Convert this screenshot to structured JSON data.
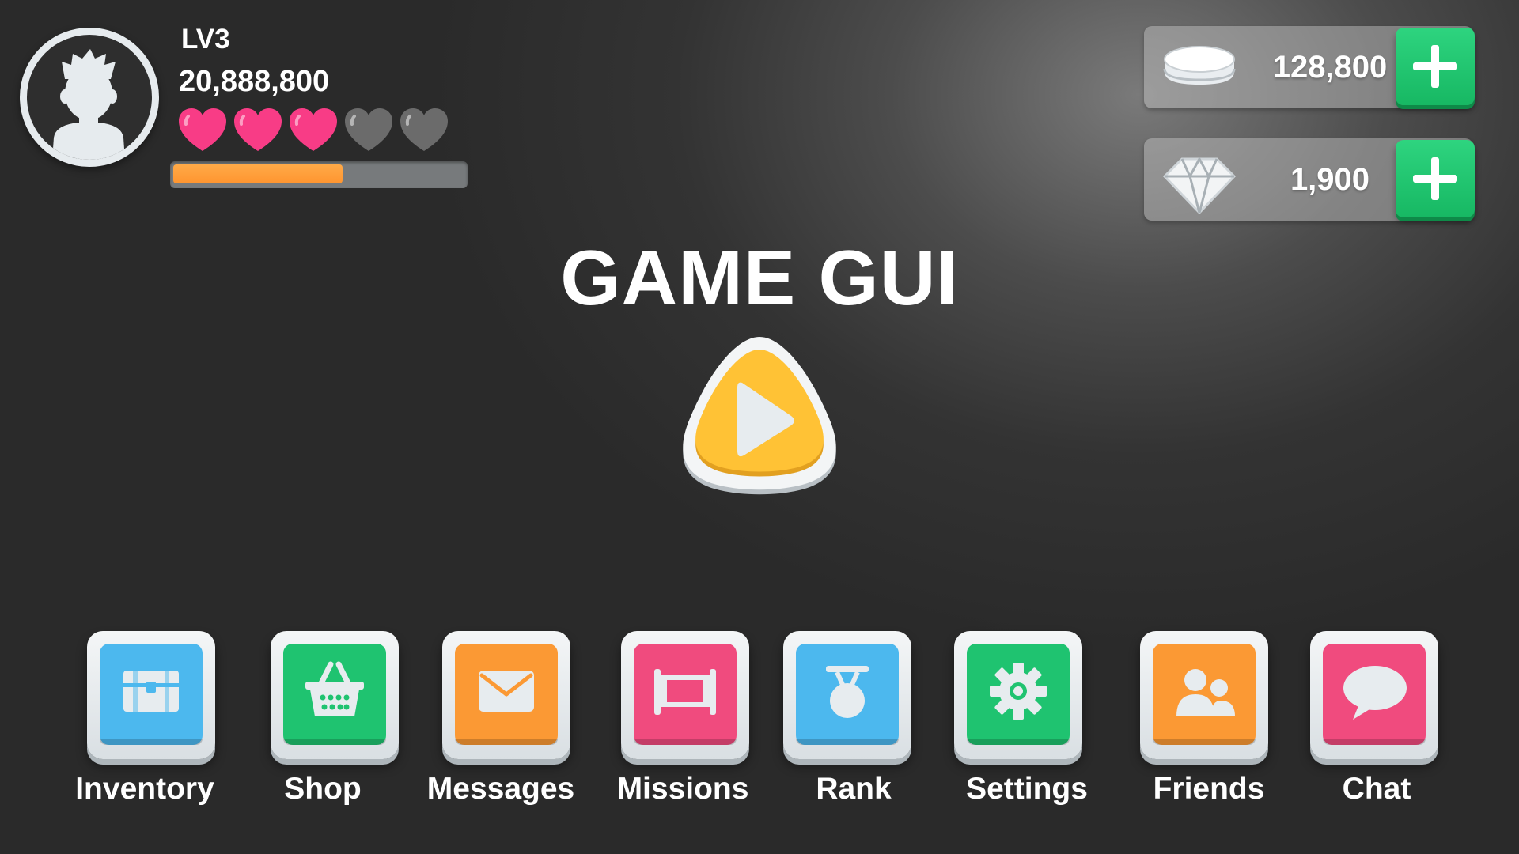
{
  "player": {
    "level_label": "LV3",
    "score": "20,888,800",
    "hearts_total": 5,
    "hearts_filled": 3,
    "xp_progress": 0.57
  },
  "currencies": {
    "coins": {
      "icon": "coin-stack-icon",
      "amount": "128,800"
    },
    "gems": {
      "icon": "diamond-icon",
      "amount": "1,900"
    }
  },
  "title": "GAME GUI",
  "play": {
    "icon": "play-icon"
  },
  "menu": [
    {
      "label": "Inventory",
      "icon": "chest-icon",
      "color": "#4cb8ee"
    },
    {
      "label": "Shop",
      "icon": "basket-icon",
      "color": "#1fc370"
    },
    {
      "label": "Messages",
      "icon": "envelope-icon",
      "color": "#fb9934"
    },
    {
      "label": "Missions",
      "icon": "scroll-icon",
      "color": "#f04b7e"
    },
    {
      "label": "Rank",
      "icon": "medal-icon",
      "color": "#4cb8ee"
    },
    {
      "label": "Settings",
      "icon": "gear-icon",
      "color": "#1fc370"
    },
    {
      "label": "Friends",
      "icon": "friends-icon",
      "color": "#fb9934"
    },
    {
      "label": "Chat",
      "icon": "chat-bubble-icon",
      "color": "#f04b7e"
    }
  ],
  "colors": {
    "heart_filled": "#f83c86",
    "heart_empty": "#6b6b6b",
    "xp_fill": "#ff9d3a",
    "plus_button": "#1fc370",
    "play_button": "#ffc235"
  }
}
